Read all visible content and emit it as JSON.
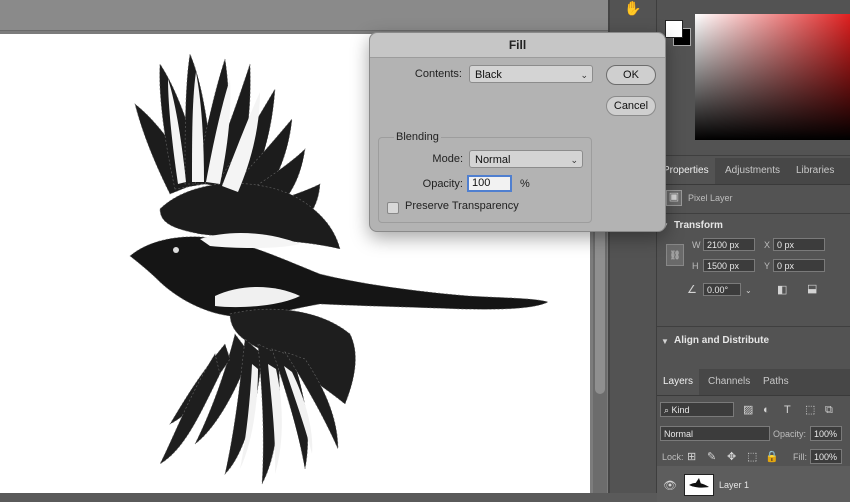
{
  "app": {
    "tool_icon": "hand-tool-icon"
  },
  "dialog": {
    "title": "Fill",
    "contents_label": "Contents:",
    "contents_value": "Black",
    "ok_label": "OK",
    "cancel_label": "Cancel",
    "blending_label": "Blending",
    "mode_label": "Mode:",
    "mode_value": "Normal",
    "opacity_label": "Opacity:",
    "opacity_value": "100",
    "opacity_unit": "%",
    "preserve_label": "Preserve Transparency",
    "preserve_checked": false
  },
  "properties": {
    "tabs": [
      "Properties",
      "Adjustments",
      "Libraries"
    ],
    "layer_type": "Pixel Layer",
    "transform_title": "Transform",
    "w_label": "W",
    "w_value": "2100 px",
    "h_label": "H",
    "h_value": "1500 px",
    "x_label": "X",
    "x_value": "0 px",
    "y_label": "Y",
    "y_value": "0 px",
    "angle_value": "0.00°",
    "align_title": "Align and Distribute"
  },
  "layers": {
    "tabs": [
      "Layers",
      "Channels",
      "Paths"
    ],
    "filter_value": "Kind",
    "blend_value": "Normal",
    "opacity_label": "Opacity:",
    "opacity_value": "100%",
    "lock_label": "Lock:",
    "fill_label": "Fill:",
    "fill_value": "100%",
    "layer_name": "Layer 1"
  },
  "colors": {
    "accent": "#4f7fd0",
    "picker_hue": "#e02020"
  }
}
